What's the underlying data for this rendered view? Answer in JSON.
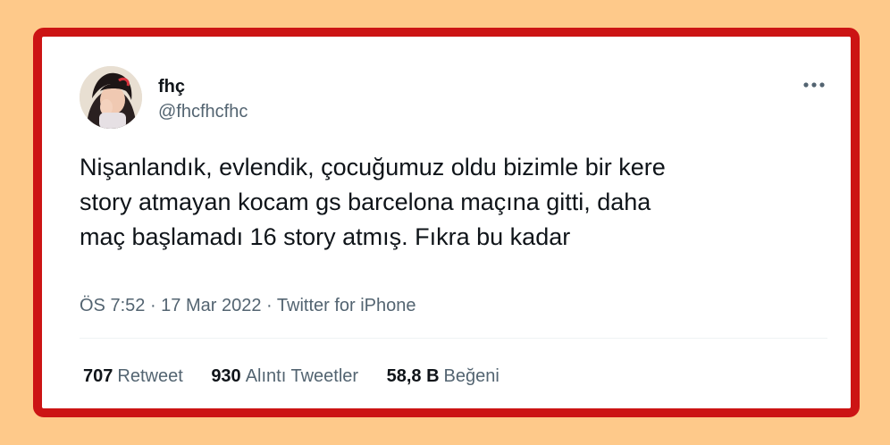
{
  "tweet": {
    "author": {
      "name": "fhç",
      "handle": "@fhcfhcfhc"
    },
    "text": "Nişanlandık, evlendik, çocuğumuz oldu bizimle bir kere\nstory atmayan kocam gs barcelona maçına gitti, daha\nmaç başlamadı 16 story atmış. Fıkra bu kadar",
    "time": "ÖS 7:52",
    "separator": " · ",
    "date": "17 Mar 2022",
    "source": "Twitter for iPhone",
    "stats": {
      "retweets_count": "707",
      "retweets_label": "Retweet",
      "quotes_count": "930",
      "quotes_label": "Alıntı Tweetler",
      "likes_count": "58,8 B",
      "likes_label": "Beğeni"
    }
  },
  "colors": {
    "background": "#fec98a",
    "frame_border": "#cc1414",
    "card": "#ffffff",
    "text_primary": "#0f1419",
    "text_secondary": "#536471"
  },
  "icons": {
    "more": "more-horizontal-icon"
  }
}
